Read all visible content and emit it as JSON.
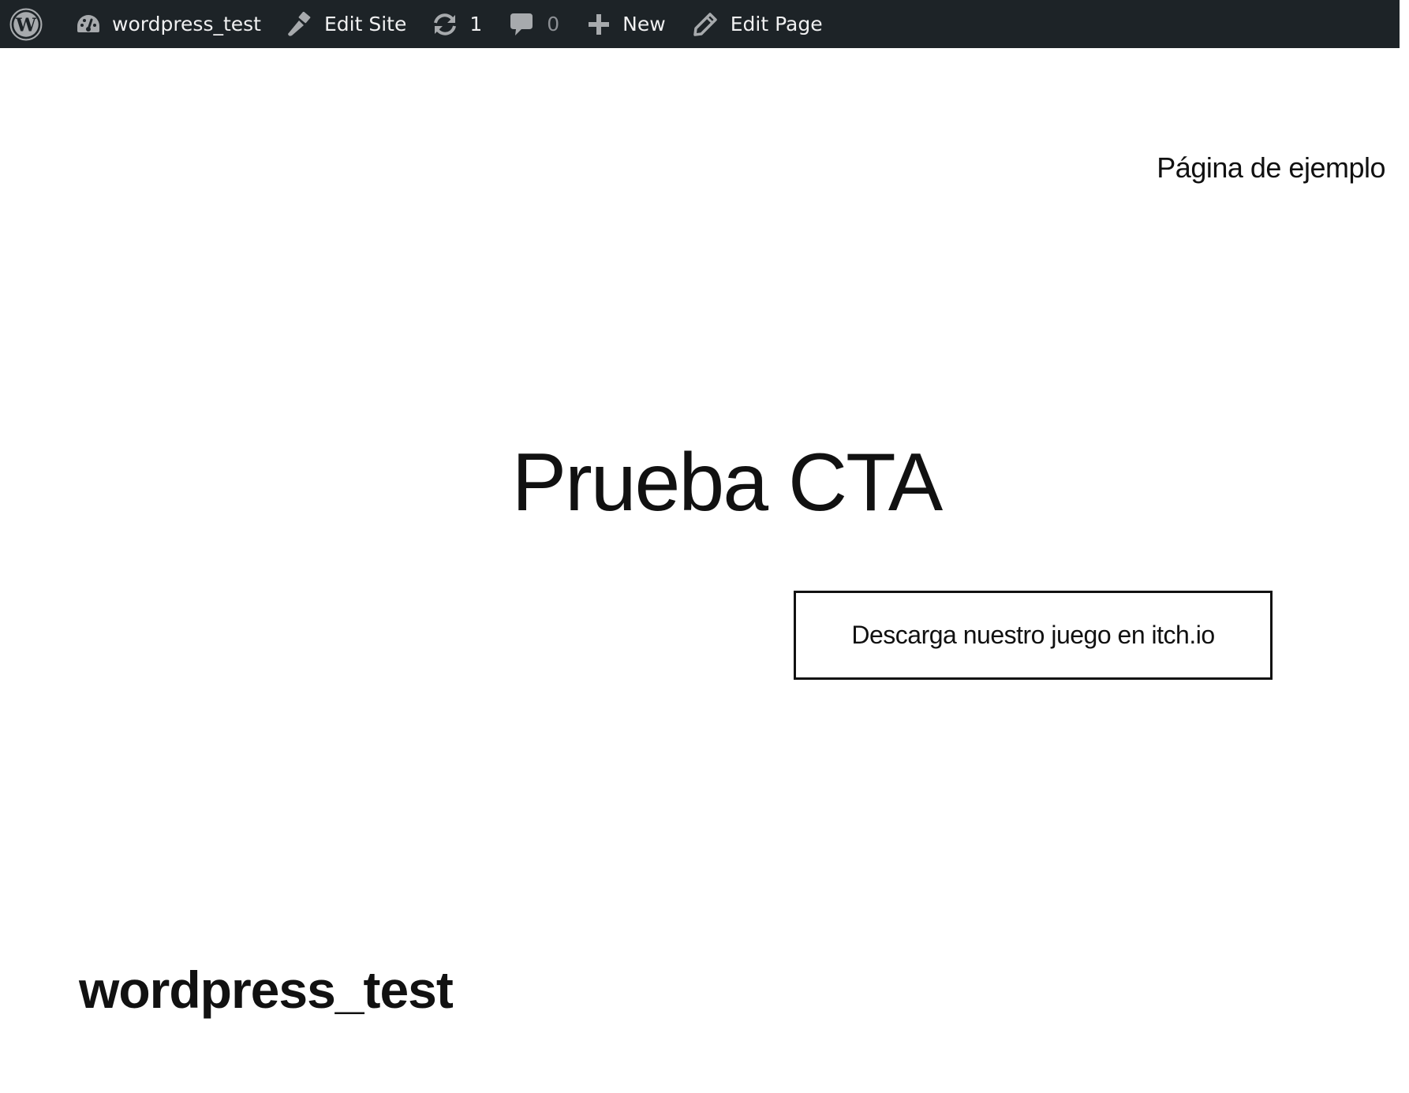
{
  "admin_bar": {
    "background": "#1d2327",
    "text_color": "#f0f0f1",
    "muted_color": "#8c8f94",
    "wp_logo_icon": "wordpress-logo-icon",
    "site": {
      "icon": "dashboard-icon",
      "label": "wordpress_test"
    },
    "edit_site": {
      "icon": "brush-icon",
      "label": "Edit Site"
    },
    "updates": {
      "icon": "update-icon",
      "count": "1"
    },
    "comments": {
      "icon": "comment-icon",
      "count": "0"
    },
    "new_content": {
      "icon": "plus-icon",
      "label": "New"
    },
    "edit_page": {
      "icon": "pencil-icon",
      "label": "Edit Page"
    }
  },
  "header": {
    "nav_link": "Página de ejemplo"
  },
  "main": {
    "title": "Prueba CTA",
    "cta_label": "Descarga nuestro juego en itch.io"
  },
  "footer": {
    "site_title": "wordpress_test"
  }
}
